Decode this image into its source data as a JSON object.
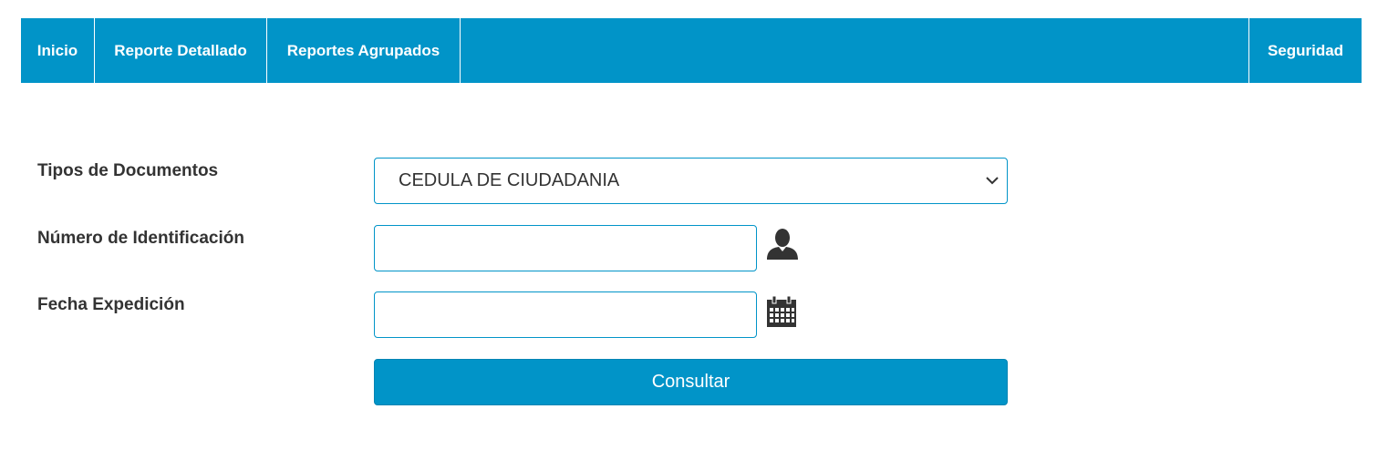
{
  "nav": {
    "items": [
      {
        "label": "Inicio"
      },
      {
        "label": "Reporte Detallado"
      },
      {
        "label": "Reportes Agrupados"
      }
    ],
    "right_item": {
      "label": "Seguridad"
    },
    "color": "#0194c8"
  },
  "form": {
    "document_type": {
      "label": "Tipos de Documentos",
      "selected": "CEDULA DE CIUDADANIA"
    },
    "id_number": {
      "label": "Número de Identificación",
      "value": "",
      "icon": "user-icon"
    },
    "issue_date": {
      "label": "Fecha Expedición",
      "value": "",
      "icon": "calendar-icon"
    },
    "submit_label": "Consultar"
  }
}
